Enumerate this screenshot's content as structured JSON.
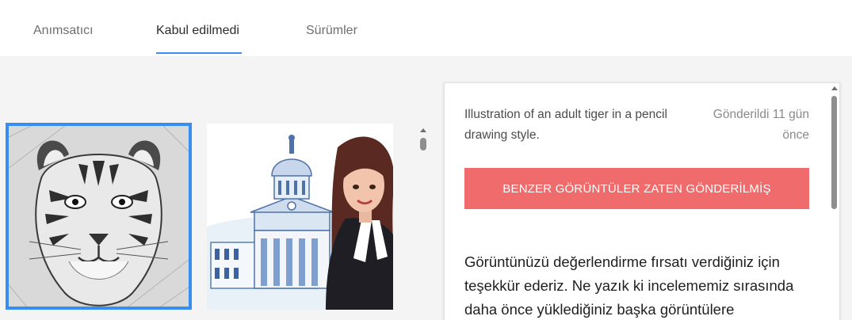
{
  "tabs": [
    {
      "label": "Anımsatıcı",
      "active": false
    },
    {
      "label": "Kabul edilmedi",
      "active": true
    },
    {
      "label": "Sürümler",
      "active": false
    }
  ],
  "gallery": {
    "items": [
      {
        "name": "tiger-pencil-drawing",
        "selected": true
      },
      {
        "name": "lawyer-and-courthouse",
        "selected": false
      }
    ]
  },
  "detail": {
    "description": "Illustration of an adult tiger in a pencil drawing style.",
    "submitted": "Gönderildi 11 gün önce",
    "reason_banner": "BENZER GÖRÜNTÜLER ZATEN GÖNDERİLMİŞ",
    "message": "Görüntünüzü değerlendirme fırsatı verdiğiniz için teşekkür ederiz. Ne yazık ki incelememiz sırasında daha önce yüklediğiniz başka görüntülere"
  },
  "colors": {
    "accent": "#378ef0",
    "reject": "#f06b6b"
  }
}
